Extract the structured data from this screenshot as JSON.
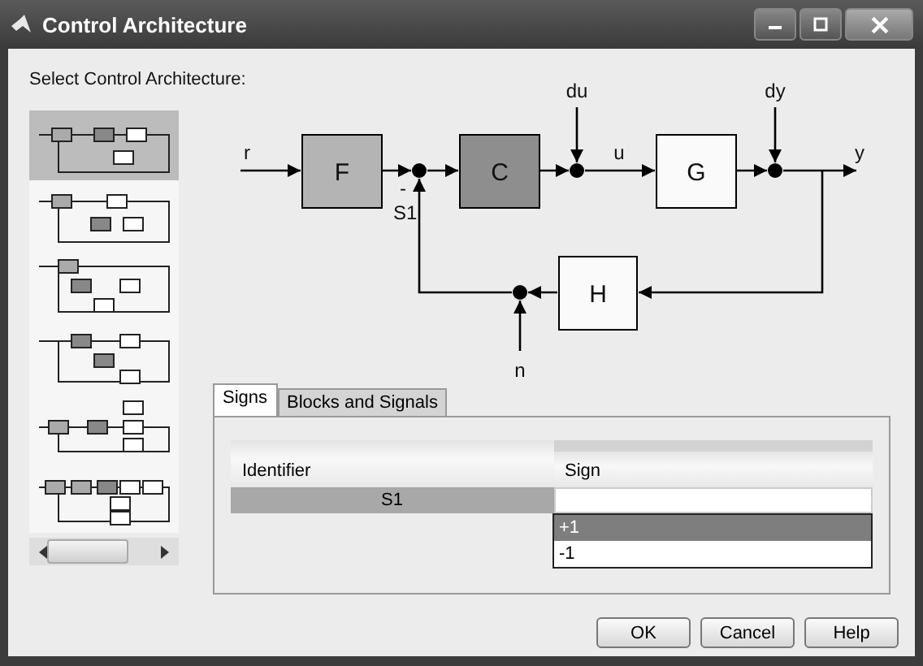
{
  "window": {
    "title": "Control Architecture"
  },
  "prompt": "Select Control Architecture:",
  "architectures": [
    {
      "selected": true
    },
    {
      "selected": false
    },
    {
      "selected": false
    },
    {
      "selected": false
    },
    {
      "selected": false
    },
    {
      "selected": false
    }
  ],
  "diagram": {
    "blocks": [
      {
        "label": "F",
        "color": "#b4b4b4"
      },
      {
        "label": "C",
        "color": "#8e8e8e"
      },
      {
        "label": "G",
        "color": "#fafafa"
      },
      {
        "label": "H",
        "color": "#fafafa"
      }
    ],
    "signals": [
      "r",
      "du",
      "u",
      "dy",
      "y",
      "n"
    ],
    "sum_label": "S1",
    "sum_sign": "-"
  },
  "tabs": [
    {
      "label": "Signs",
      "selected": true
    },
    {
      "label": "Blocks and Signals",
      "selected": false
    }
  ],
  "table": {
    "columns": [
      "Identifier",
      "Sign"
    ],
    "rows": [
      {
        "identifier": "S1",
        "selected": true
      }
    ]
  },
  "sign_dropdown": {
    "options": [
      {
        "label": "+1",
        "selected": true
      },
      {
        "label": "-1",
        "selected": false
      }
    ]
  },
  "buttons": [
    "OK",
    "Cancel",
    "Help"
  ]
}
